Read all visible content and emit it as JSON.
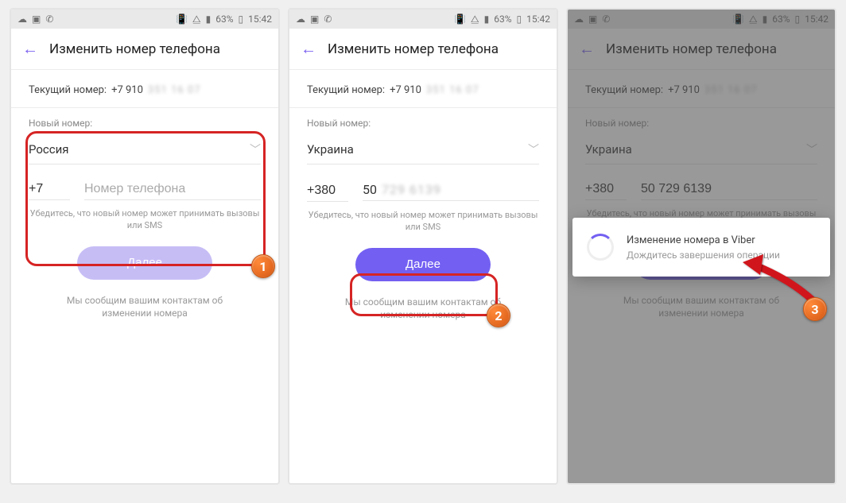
{
  "statusbar": {
    "battery": "63%",
    "time": "15:42",
    "icons_left": [
      "cloud-icon",
      "screenshot-icon",
      "viber-icon"
    ],
    "icons_right": [
      "vibrate-icon",
      "wifi-icon",
      "signal-icon"
    ]
  },
  "header": {
    "title": "Изменить номер телефона"
  },
  "current": {
    "label": "Текущий номер:",
    "prefix_visible": "+7 910",
    "rest_masked": "351 16 07"
  },
  "new_number": {
    "label": "Новый номер:",
    "hint": "Убедитесь, что новый номер может принимать вызовы или SMS",
    "phone_placeholder": "Номер телефона"
  },
  "screens": [
    {
      "country": "Россия",
      "code": "+7",
      "phone_value": "",
      "button_enabled": false
    },
    {
      "country": "Украина",
      "code": "+380",
      "phone_value_visible": "50",
      "phone_value_masked": "729 6139",
      "button_enabled": true
    },
    {
      "country": "Украина",
      "code": "+380",
      "phone_value": "50 729 6139"
    }
  ],
  "button_label": "Далее",
  "footer_note": "Мы сообщим вашим контактам об изменении номера",
  "dialog": {
    "title": "Изменение номера в Viber",
    "subtitle": "Дождитесь завершения операции"
  },
  "colors": {
    "accent": "#7360f2",
    "highlight": "#d62424",
    "badge": "#ec6b1f"
  }
}
